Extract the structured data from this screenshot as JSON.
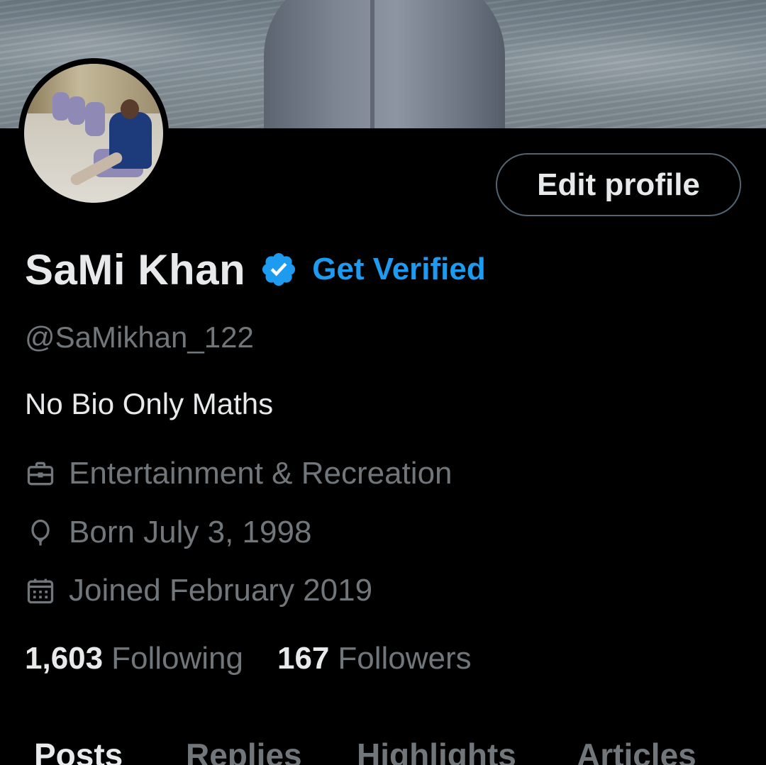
{
  "profile": {
    "name": "SaMi Khan",
    "get_verified": "Get Verified",
    "handle": "@SaMikhan_122",
    "bio": "No Bio Only Maths",
    "category": "Entertainment & Recreation",
    "born": "Born July 3, 1998",
    "joined": "Joined February 2019"
  },
  "actions": {
    "edit_profile": "Edit profile"
  },
  "stats": {
    "following_count": "1,603",
    "following_label": "Following",
    "followers_count": "167",
    "followers_label": "Followers"
  },
  "tabs": [
    "Posts",
    "Replies",
    "Highlights",
    "Articles"
  ],
  "colors": {
    "background": "#000000",
    "text_primary": "#e7e9ea",
    "text_secondary": "#71767b",
    "accent": "#1d9bf0",
    "button_border": "#536471"
  },
  "icons": {
    "verified": "verified-badge-icon",
    "category": "briefcase-icon",
    "born": "balloon-icon",
    "joined": "calendar-icon"
  }
}
